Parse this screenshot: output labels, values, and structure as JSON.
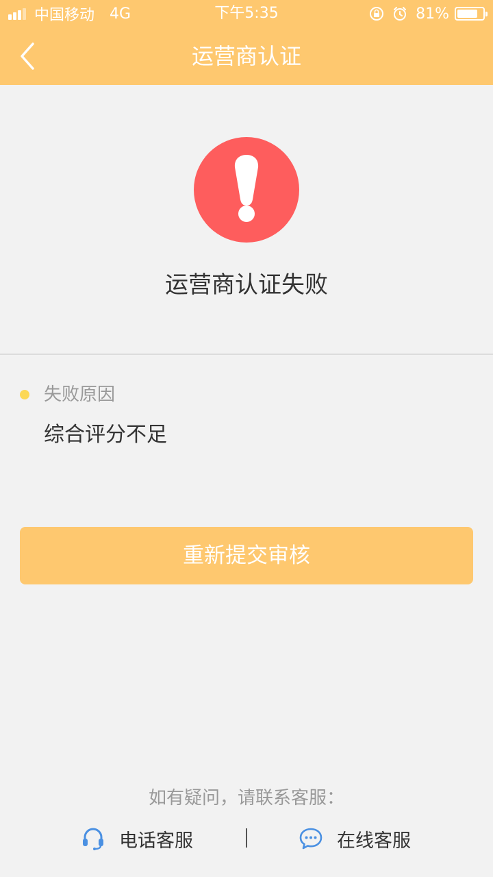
{
  "status_bar": {
    "carrier": "中国移动",
    "network": "4G",
    "time": "下午5:35",
    "battery_percent": "81%",
    "battery_level": 0.81,
    "icons": [
      "signal-icon",
      "orientation-lock-icon",
      "alarm-icon",
      "battery-icon"
    ]
  },
  "nav": {
    "title": "运营商认证",
    "back_icon": "chevron-left-icon"
  },
  "result": {
    "icon": "exclamation-circle-icon",
    "icon_color": "#fe5d5d",
    "title": "运营商认证失败"
  },
  "reason": {
    "label": "失败原因",
    "text": "综合评分不足",
    "dot_color": "#fcd855"
  },
  "actions": {
    "resubmit_label": "重新提交审核"
  },
  "help": {
    "text": "如有疑问，请联系客服：",
    "phone_label": "电话客服",
    "phone_icon": "headset-icon",
    "online_label": "在线客服",
    "online_icon": "chat-bubble-icon"
  },
  "colors": {
    "accent": "#fec86f",
    "background": "#f2f2f2",
    "link_icon": "#4a90e2"
  }
}
